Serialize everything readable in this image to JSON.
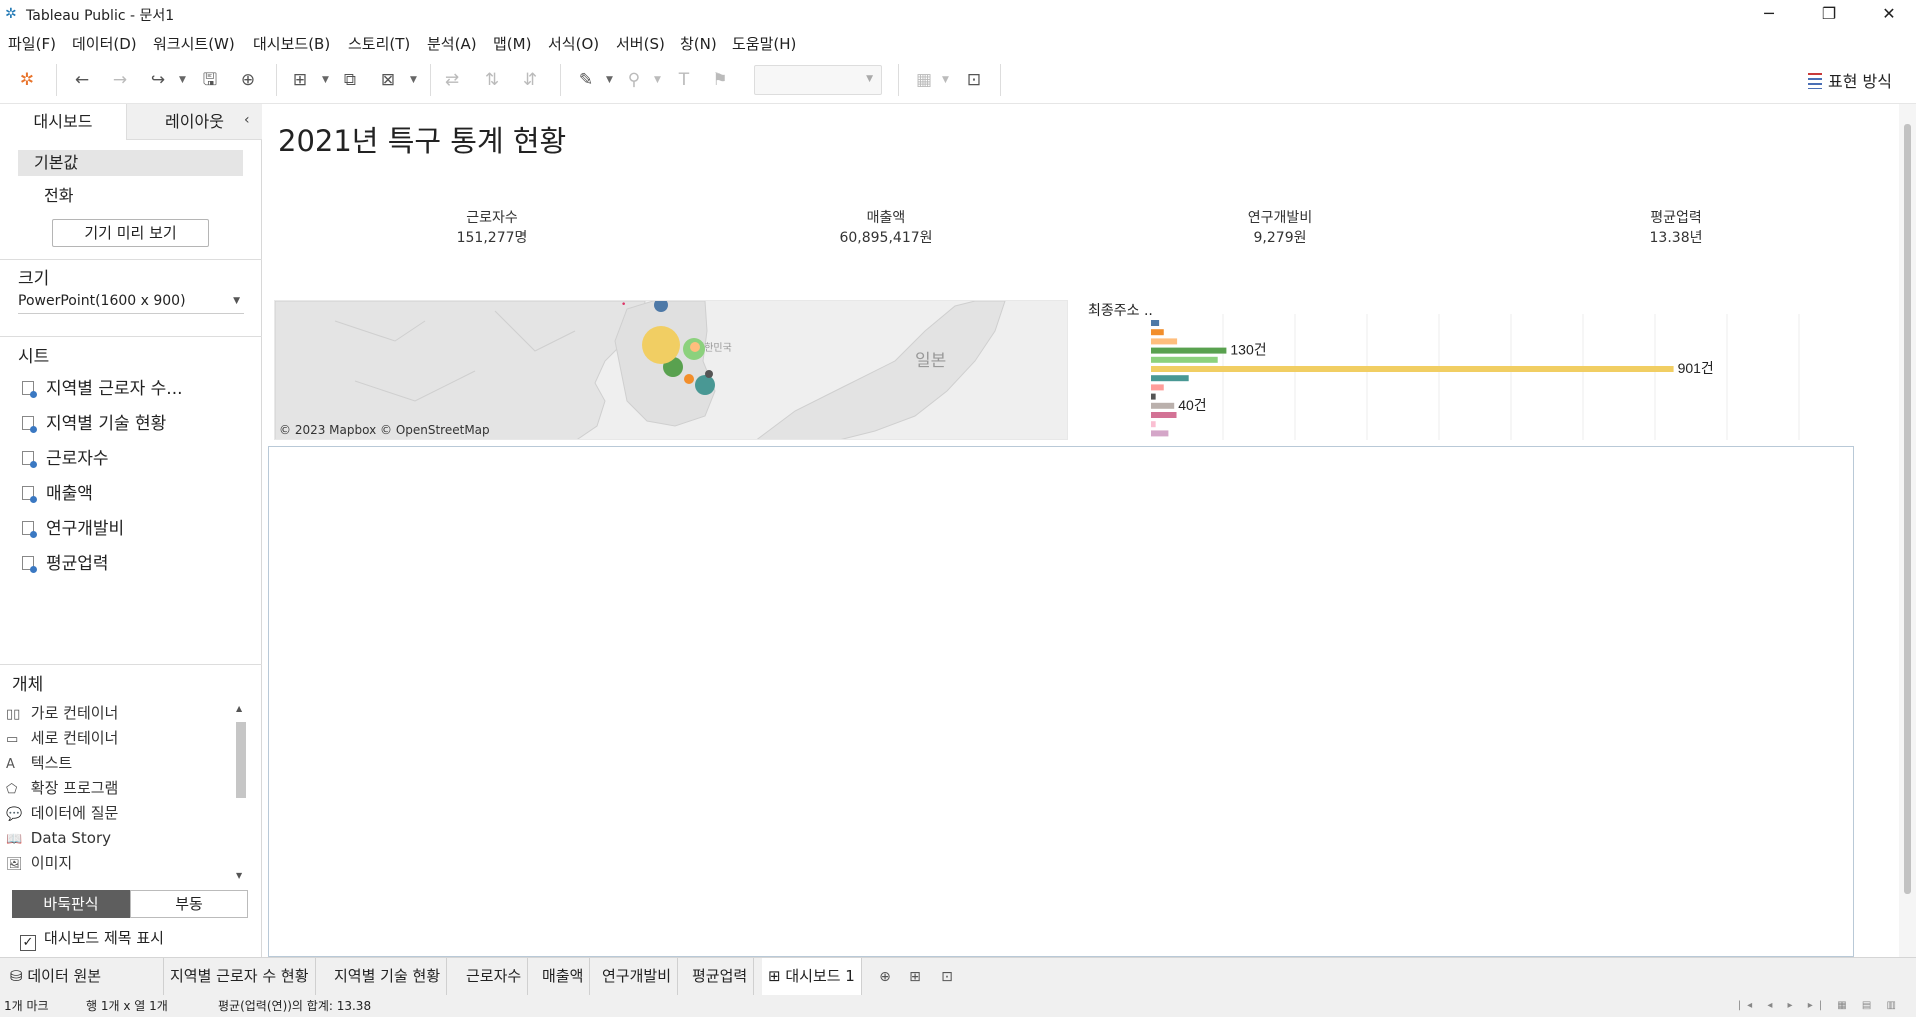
{
  "window": {
    "title": "Tableau Public - 문서1",
    "minimize": "─",
    "restore": "❐",
    "close": "✕"
  },
  "menu": [
    "파일(F)",
    "데이터(D)",
    "워크시트(W)",
    "대시보드(B)",
    "스토리(T)",
    "분석(A)",
    "맵(M)",
    "서식(O)",
    "서버(S)",
    "창(N)",
    "도움말(H)"
  ],
  "toolbar": {
    "show_me_label": "표현 방식"
  },
  "left_panel": {
    "tabs": [
      "대시보드",
      "레이아웃"
    ],
    "device": {
      "default_label": "기본값",
      "phone_label": "전화",
      "preview_button": "기기 미리 보기"
    },
    "size": {
      "title": "크기",
      "value": "PowerPoint(1600 x 900)"
    },
    "sheets": {
      "title": "시트",
      "items": [
        "지역별 근로자 수...",
        "지역별 기술 현황",
        "근로자수",
        "매출액",
        "연구개발비",
        "평균업력"
      ]
    },
    "objects": {
      "title": "개체",
      "items": [
        {
          "icon": "horizontal-container-icon",
          "label": "가로 컨테이너"
        },
        {
          "icon": "vertical-container-icon",
          "label": "세로 컨테이너"
        },
        {
          "icon": "text-icon",
          "label": "텍스트"
        },
        {
          "icon": "extension-icon",
          "label": "확장 프로그램"
        },
        {
          "icon": "ask-data-icon",
          "label": "데이터에 질문"
        },
        {
          "icon": "data-story-icon",
          "label": "Data Story"
        },
        {
          "icon": "image-icon",
          "label": "이미지"
        }
      ]
    },
    "layout_mode": {
      "tiled": "바둑판식",
      "floating": "부동"
    },
    "show_title": "대시보드 제목 표시"
  },
  "dashboard": {
    "title": "2021년 특구 통계 현황",
    "kpis": [
      {
        "label": "근로자수",
        "value": "151,277명"
      },
      {
        "label": "매출액",
        "value": "60,895,417원"
      },
      {
        "label": "연구개발비",
        "value": "9,279원"
      },
      {
        "label": "평균업력",
        "value": "13.38년"
      }
    ],
    "map": {
      "credit": "© 2023 Mapbox © OpenStreetMap",
      "label_japan": "일본",
      "label_korea": "대한민국"
    },
    "bar_header": "최종주소 ..",
    "bar_labels_visible": [
      "130건",
      "901건",
      "40건"
    ]
  },
  "chart_data": {
    "type": "bar",
    "orientation": "horizontal",
    "title": "",
    "categories": [
      "",
      "",
      "",
      "",
      "",
      "",
      "",
      "",
      "",
      "",
      "",
      "",
      ""
    ],
    "values": [
      14,
      22,
      45,
      130,
      115,
      901,
      65,
      22,
      8,
      40,
      44,
      8,
      30
    ],
    "colors": [
      "#4e79a7",
      "#f28e2b",
      "#ffbe7d",
      "#59a14f",
      "#8cd17d",
      "#f1ce63",
      "#499894",
      "#ff9d9a",
      "#555555",
      "#bab0ac",
      "#d37295",
      "#fabfd2",
      "#d4a6c8"
    ],
    "data_labels": [
      "",
      "",
      "",
      "130건",
      "",
      "901건",
      "",
      "",
      "",
      "40건",
      "",
      "",
      ""
    ],
    "xlim": [
      0,
      1000
    ],
    "grid": true
  },
  "tabs": {
    "data_source": "데이터 원본",
    "sheets": [
      "지역별 근로자 수 현황",
      "지역별 기술 현황",
      "근로자수",
      "매출액",
      "연구개발비",
      "평균업력",
      "대시보드 1"
    ]
  },
  "status": {
    "marks": "1개 마크",
    "rows_cols": "행 1개  x  열 1개",
    "sum": "평균(업력(연))의 합계: 13.38"
  }
}
